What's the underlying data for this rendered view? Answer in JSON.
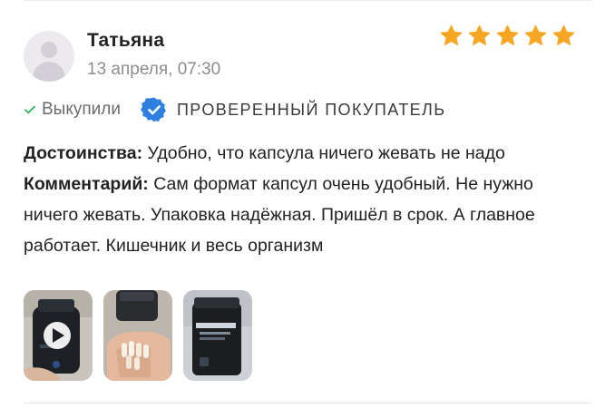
{
  "review": {
    "author": "Татьяна",
    "date": "13 апреля, 07:30",
    "rating": 5,
    "bought_label": "Выкупили",
    "verified_label": "ПРОВЕРЕННЫЙ ПОКУПАТЕЛЬ",
    "advantages_label": "Достоинства:",
    "advantages_text": "Удобно, что капсула ничего жевать не надо",
    "comment_label": "Комментарий:",
    "comment_text": "Сам формат капсул очень удобный. Не нужно ничего жевать. Упаковка надёжная. Пришёл в срок. А главное работает. Кишечник и весь организм"
  },
  "photos": [
    {
      "kind": "video",
      "icon": "play-icon"
    },
    {
      "kind": "image"
    },
    {
      "kind": "image"
    }
  ],
  "colors": {
    "star": "#f6a623",
    "check": "#2fb35a",
    "verified_badge": "#2d7fe0",
    "muted_text": "#8d8d8d"
  }
}
